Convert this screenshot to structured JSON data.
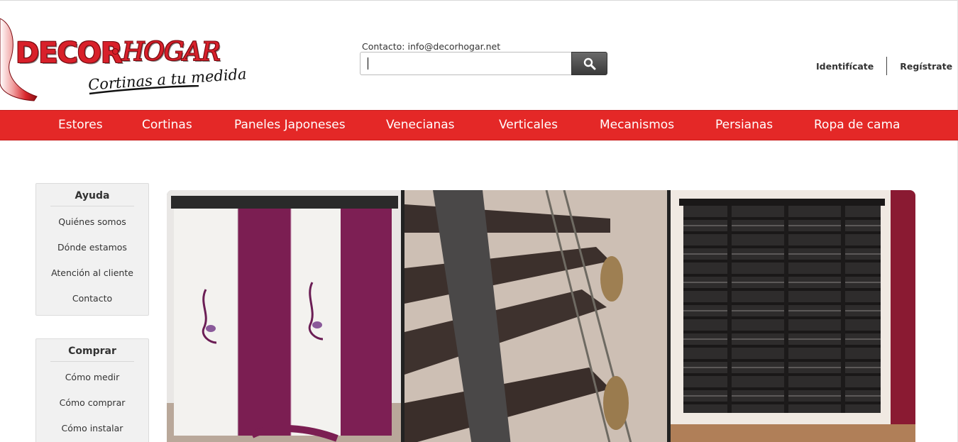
{
  "header": {
    "logo": {
      "brand_left": "DECOR",
      "brand_right": "HOGAR",
      "tagline": "Cortinas a tu medida",
      "brand_color": "#d8202a"
    },
    "contact_text": "Contacto: info@decorhogar.net",
    "search": {
      "value": "",
      "placeholder": "",
      "button_icon": "search-icon"
    },
    "account": {
      "login_label": "Identifícate",
      "register_label": "Regístrate"
    }
  },
  "nav": {
    "color": "#e42827",
    "items": [
      {
        "label": "Estores"
      },
      {
        "label": "Cortinas"
      },
      {
        "label": "Paneles Japoneses"
      },
      {
        "label": "Venecianas"
      },
      {
        "label": "Verticales"
      },
      {
        "label": "Mecanismos"
      },
      {
        "label": "Persianas"
      },
      {
        "label": "Ropa de cama"
      }
    ]
  },
  "sidebar": {
    "help": {
      "title": "Ayuda",
      "links": [
        "Quiénes somos",
        "Dónde estamos",
        "Atención al cliente",
        "Contacto"
      ]
    },
    "buy": {
      "title": "Comprar",
      "links": [
        "Cómo medir",
        "Cómo comprar",
        "Cómo instalar"
      ]
    }
  },
  "banner": {
    "panels": [
      "japanese-panels-photo",
      "wood-blinds-closeup-photo",
      "venetian-blind-window-photo"
    ]
  }
}
